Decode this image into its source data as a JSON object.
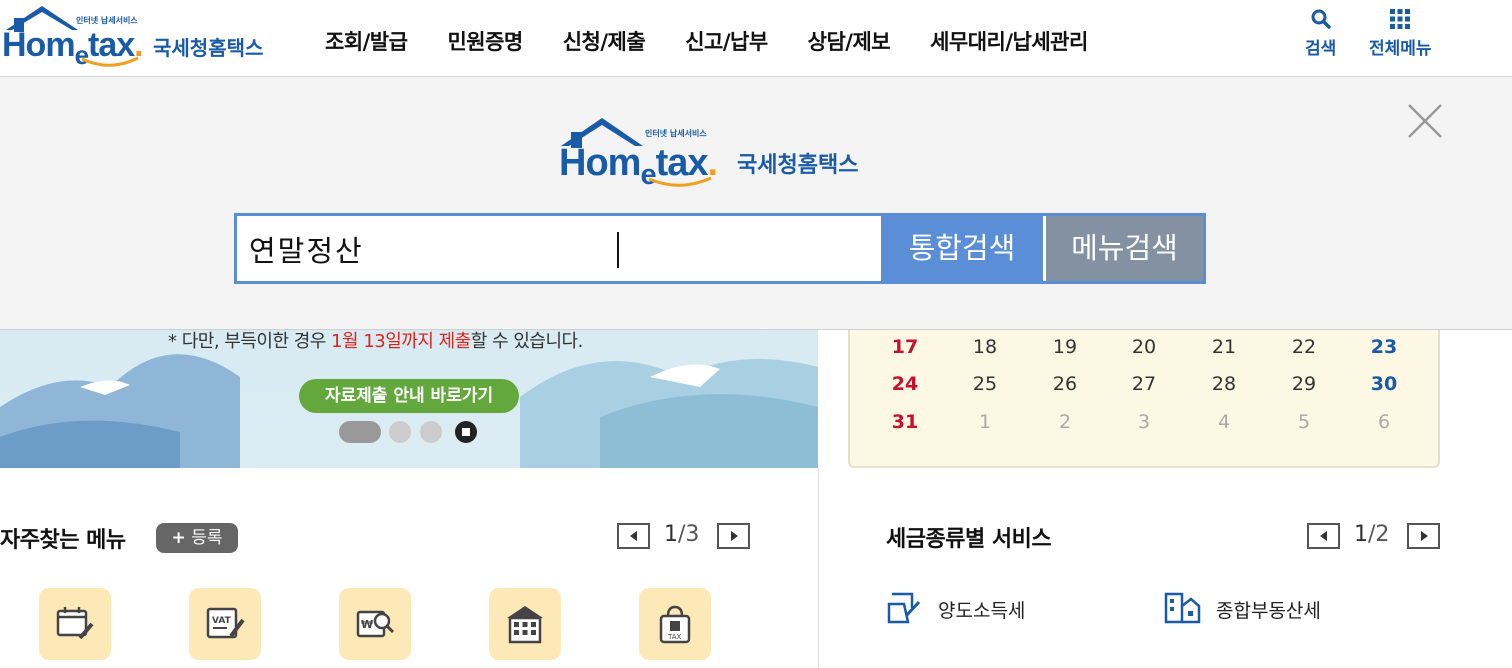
{
  "brand": {
    "logo_small": "인터넷 납세서비스",
    "logo_word_a": "Hom",
    "logo_word_e": "e",
    "logo_word_b": "tax",
    "logo_dot": ".",
    "logo_kor": "국세청홈택스"
  },
  "gnb": [
    "조회/발급",
    "민원증명",
    "신청/제출",
    "신고/납부",
    "상담/제보",
    "세무대리/납세관리"
  ],
  "utility": {
    "search_label": "검색",
    "allmenu_label": "전체메뉴"
  },
  "search": {
    "value": "연말정산",
    "btn_integrated": "통합검색",
    "btn_menu": "메뉴검색"
  },
  "banner": {
    "note_prefix": "* 다만, 부득이한 경우 ",
    "note_red": "1월 13일까지 제출",
    "note_suffix": "할 수 있습니다.",
    "cta": "자료제출 안내 바로가기"
  },
  "calendar": {
    "rows": [
      [
        {
          "d": "17",
          "t": "sun"
        },
        {
          "d": "18",
          "t": ""
        },
        {
          "d": "19",
          "t": ""
        },
        {
          "d": "20",
          "t": ""
        },
        {
          "d": "21",
          "t": ""
        },
        {
          "d": "22",
          "t": ""
        },
        {
          "d": "23",
          "t": "sat"
        }
      ],
      [
        {
          "d": "24",
          "t": "sun"
        },
        {
          "d": "25",
          "t": ""
        },
        {
          "d": "26",
          "t": ""
        },
        {
          "d": "27",
          "t": ""
        },
        {
          "d": "28",
          "t": ""
        },
        {
          "d": "29",
          "t": ""
        },
        {
          "d": "30",
          "t": "sat"
        }
      ],
      [
        {
          "d": "31",
          "t": "sun"
        },
        {
          "d": "1",
          "t": "muted"
        },
        {
          "d": "2",
          "t": "muted"
        },
        {
          "d": "3",
          "t": "muted"
        },
        {
          "d": "4",
          "t": "muted"
        },
        {
          "d": "5",
          "t": "muted"
        },
        {
          "d": "6",
          "t": "muted"
        }
      ]
    ]
  },
  "frequent": {
    "title": "자주찾는 메뉴",
    "register": "등록",
    "page_cur": "1",
    "page_sep": "/",
    "page_total": "3"
  },
  "tax_service": {
    "title": "세금종류별 서비스",
    "page_cur": "1",
    "page_sep": "/",
    "page_total": "2",
    "items": [
      "양도소득세",
      "종합부동산세"
    ]
  },
  "colors": {
    "brand_blue": "#1a5ba8",
    "search_blue": "#5a8fd8",
    "menu_gray": "#8391a3",
    "cta_green": "#63a83c",
    "sunday_red": "#c8102e"
  }
}
